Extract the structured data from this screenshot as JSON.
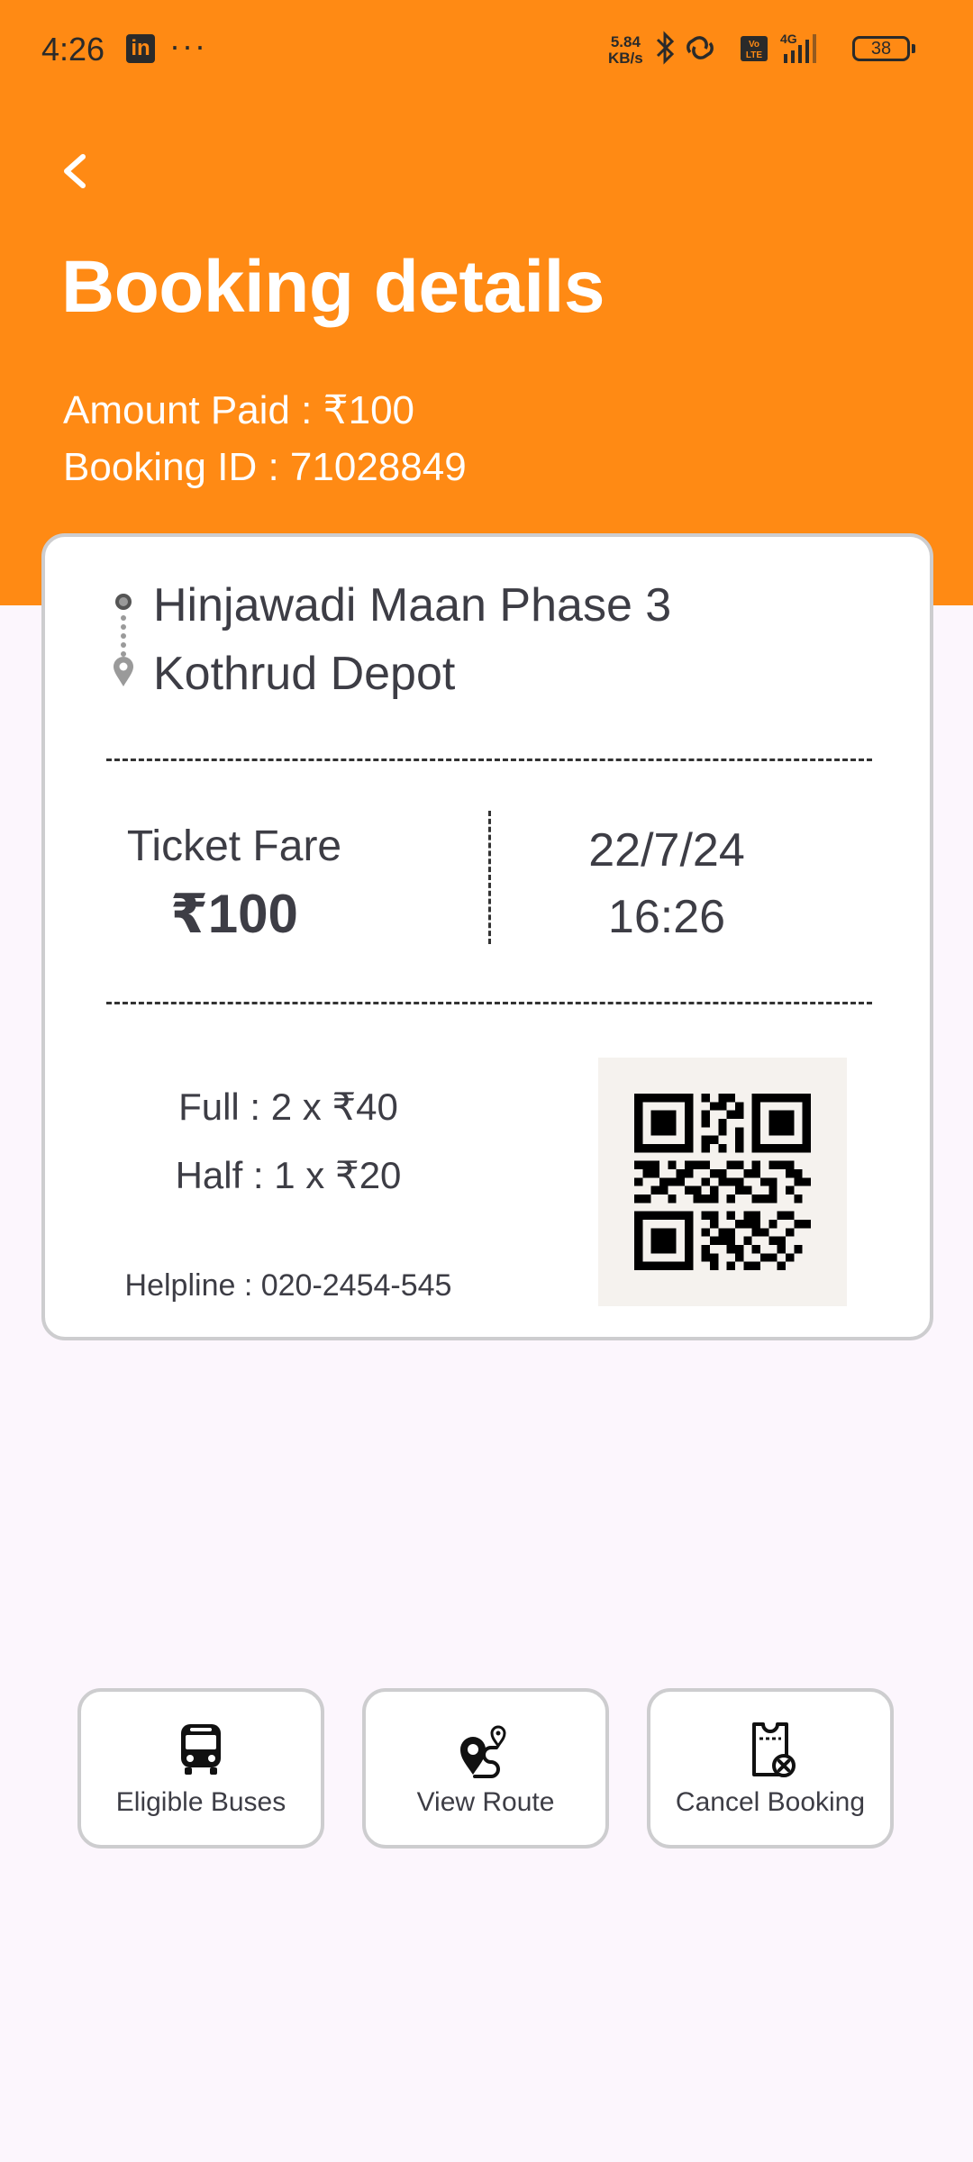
{
  "status_bar": {
    "time": "4:26",
    "linkedin_badge": "in",
    "more": "···",
    "net_speed_value": "5.84",
    "net_speed_unit": "KB/s",
    "battery": "38"
  },
  "header": {
    "back_icon": "chevron-left-icon",
    "title": "Booking details",
    "amount_paid": "Amount Paid : ₹100",
    "booking_id": "Booking ID : 71028849",
    "background_color": "#ff8a14"
  },
  "ticket": {
    "from_stop": "Hinjawadi Maan Phase 3",
    "to_stop": "Kothrud Depot",
    "fare_label": "Ticket Fare",
    "fare_value": "₹100",
    "date": "22/7/24",
    "time": "16:26",
    "full_fare": "Full : 2 x ₹40",
    "half_fare": "Half : 1 x ₹20",
    "helpline": "Helpline : 020-2454-545",
    "qr_icon": "qr-code-icon"
  },
  "actions": [
    {
      "label": "Eligible Buses",
      "icon": "bus-icon"
    },
    {
      "label": "View Route",
      "icon": "route-icon"
    },
    {
      "label": "Cancel Booking",
      "icon": "cancel-booking-icon"
    }
  ]
}
